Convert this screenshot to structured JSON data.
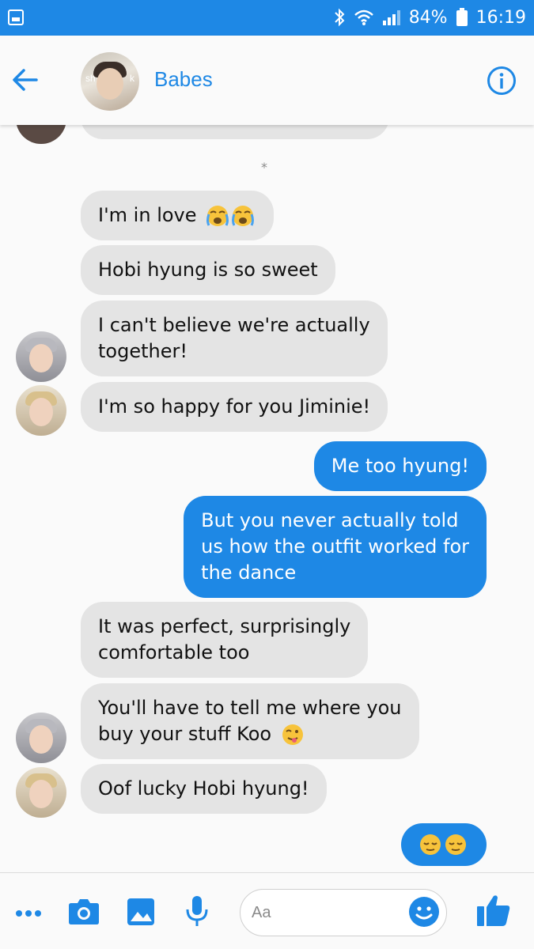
{
  "status_bar": {
    "battery": "84%",
    "time": "16:19",
    "icons": [
      "gallery-icon",
      "bluetooth-icon",
      "wifi-icon",
      "signal-icon",
      "battery-icon"
    ]
  },
  "header": {
    "contact_name": "Babes",
    "avatar_overlay_left": "sh",
    "avatar_overlay_right": "k",
    "back_icon": "arrow-left-icon",
    "info_icon": "info-icon"
  },
  "chat": {
    "divider": "*",
    "messages": [
      {
        "side": "in",
        "text": "I'm in love",
        "emoji": "loudly-crying-face x2"
      },
      {
        "side": "in",
        "text": "Hobi hyung is so sweet"
      },
      {
        "side": "in",
        "text_lines": [
          "I can't believe we're actually",
          "together!"
        ]
      },
      {
        "side": "in",
        "text": "I'm so happy for you Jiminie!"
      },
      {
        "side": "out",
        "text": "Me too hyung!"
      },
      {
        "side": "out",
        "text_lines": [
          "But you never actually told",
          "us how the outfit worked for",
          "the dance"
        ]
      },
      {
        "side": "in",
        "text_lines": [
          "It was perfect, surprisingly",
          "comfortable too"
        ]
      },
      {
        "side": "in",
        "text_lines": [
          "You'll have to tell me where you",
          "buy your stuff Koo"
        ],
        "emoji": "winking-face-with-tongue"
      },
      {
        "side": "in",
        "text": "Oof lucky Hobi hyung!"
      },
      {
        "side": "out",
        "emoji": "relieved-face x2"
      }
    ]
  },
  "composer": {
    "placeholder": "Aa",
    "icons": [
      "more-icon",
      "camera-icon",
      "image-icon",
      "microphone-icon",
      "emoji-icon",
      "thumbs-up-icon"
    ]
  },
  "colors": {
    "accent": "#1e88e5",
    "incoming_bubble": "#e4e4e4",
    "background": "#fafafa"
  }
}
